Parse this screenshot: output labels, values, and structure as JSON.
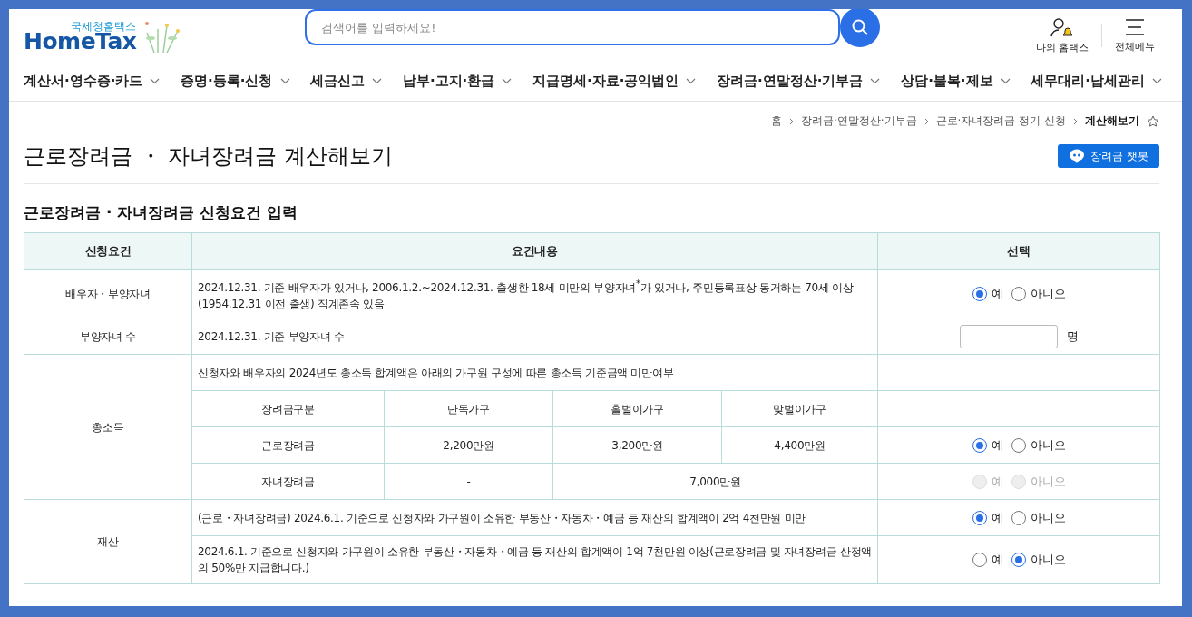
{
  "header": {
    "logo": {
      "small_text": "국세청홈택스",
      "brand": "HomeTax"
    },
    "search": {
      "placeholder": "검색어를 입력하세요!"
    },
    "utilities": [
      {
        "kind": "my",
        "label": "나의 홈택스"
      },
      {
        "kind": "menu",
        "label": "전체메뉴"
      }
    ]
  },
  "nav": [
    "계산서·영수증·카드",
    "증명·등록·신청",
    "세금신고",
    "납부·고지·환급",
    "지급명세·자료·공익법인",
    "장려금·연말정산·기부금",
    "상담·불복·제보",
    "세무대리·납세관리"
  ],
  "breadcrumb": [
    {
      "label": "홈",
      "current": false
    },
    {
      "label": "장려금·연말정산·기부금",
      "current": false
    },
    {
      "label": "근로·자녀장려금 정기 신청",
      "current": false
    },
    {
      "label": "계산해보기",
      "current": true
    }
  ],
  "page_title": "근로장려금 ・ 자녀장려금 계산해보기",
  "chatbot_button": "장려금 챗봇",
  "section_title": "근로장려금 · 자녀장려금 신청요건 입력",
  "table": {
    "columns": [
      "신청요건",
      "요건내용",
      "선택"
    ],
    "groups": [
      {
        "label": "배우자・부양자녀",
        "rows": [
          {
            "kind": "text",
            "text": "2024.12.31. 기준 배우자가 있거나, 2006.1.2.~2024.12.31. 출생한 18세 미만의 부양자녀$^{*}$가 있거나, 주민등록표상 동거하는 70세 이상(1954.12.31 이전 출생) 직계존속 있음",
            "choice": {
              "kind": "radio",
              "disabled": false,
              "options": [
                {
                  "label": "예",
                  "selected": true
                },
                {
                  "label": "아니오",
                  "selected": false
                }
              ]
            }
          }
        ]
      },
      {
        "label": "부양자녀 수",
        "rows": [
          {
            "kind": "text",
            "text": "2024.12.31. 기준 부양자녀 수",
            "choice": {
              "kind": "input",
              "unit": "명"
            }
          }
        ]
      },
      {
        "label": "총소득",
        "rows": [
          {
            "kind": "text",
            "text": "신청자와 배우자의 2024년도 총소득 합계액은 아래의 가구원 구성에 따른 총소득 기준금액 미만여부"
          },
          {
            "kind": "grid",
            "cells": [
              "장려금구분",
              "단독가구",
              "홀벌이가구",
              "맞벌이가구"
            ]
          },
          {
            "kind": "grid",
            "cells": [
              "근로장려금",
              "2,200만원",
              "3,200만원",
              "4,400만원"
            ],
            "choice": {
              "kind": "radio",
              "disabled": false,
              "options": [
                {
                  "label": "예",
                  "selected": true
                },
                {
                  "label": "아니오",
                  "selected": false
                }
              ]
            }
          },
          {
            "kind": "grid",
            "cells": [
              "자녀장려금",
              "-",
              "7,000만원"
            ],
            "choice": {
              "kind": "radio",
              "disabled": true,
              "options": [
                {
                  "label": "예",
                  "selected": false
                },
                {
                  "label": "아니오",
                  "selected": false
                }
              ]
            }
          }
        ]
      },
      {
        "label": "재산",
        "rows": [
          {
            "kind": "text",
            "text": "(근로・자녀장려금) 2024.6.1. 기준으로 신청자와 가구원이 소유한 부동산・자동차・예금 등 재산의 합계액이 2억 4천만원 미만",
            "choice": {
              "kind": "radio",
              "disabled": false,
              "options": [
                {
                  "label": "예",
                  "selected": true
                },
                {
                  "label": "아니오",
                  "selected": false
                }
              ]
            }
          },
          {
            "kind": "text",
            "text": "2024.6.1. 기준으로 신청자와 가구원이 소유한 부동산・자동차・예금 등 재산의 합계액이 1억 7천만원 이상(근로장려금 및 자녀장려금 산정액의 50%만 지급합니다.)",
            "choice": {
              "kind": "radio",
              "disabled": false,
              "options": [
                {
                  "label": "예",
                  "selected": false
                },
                {
                  "label": "아니오",
                  "selected": true
                }
              ]
            }
          }
        ]
      }
    ]
  }
}
